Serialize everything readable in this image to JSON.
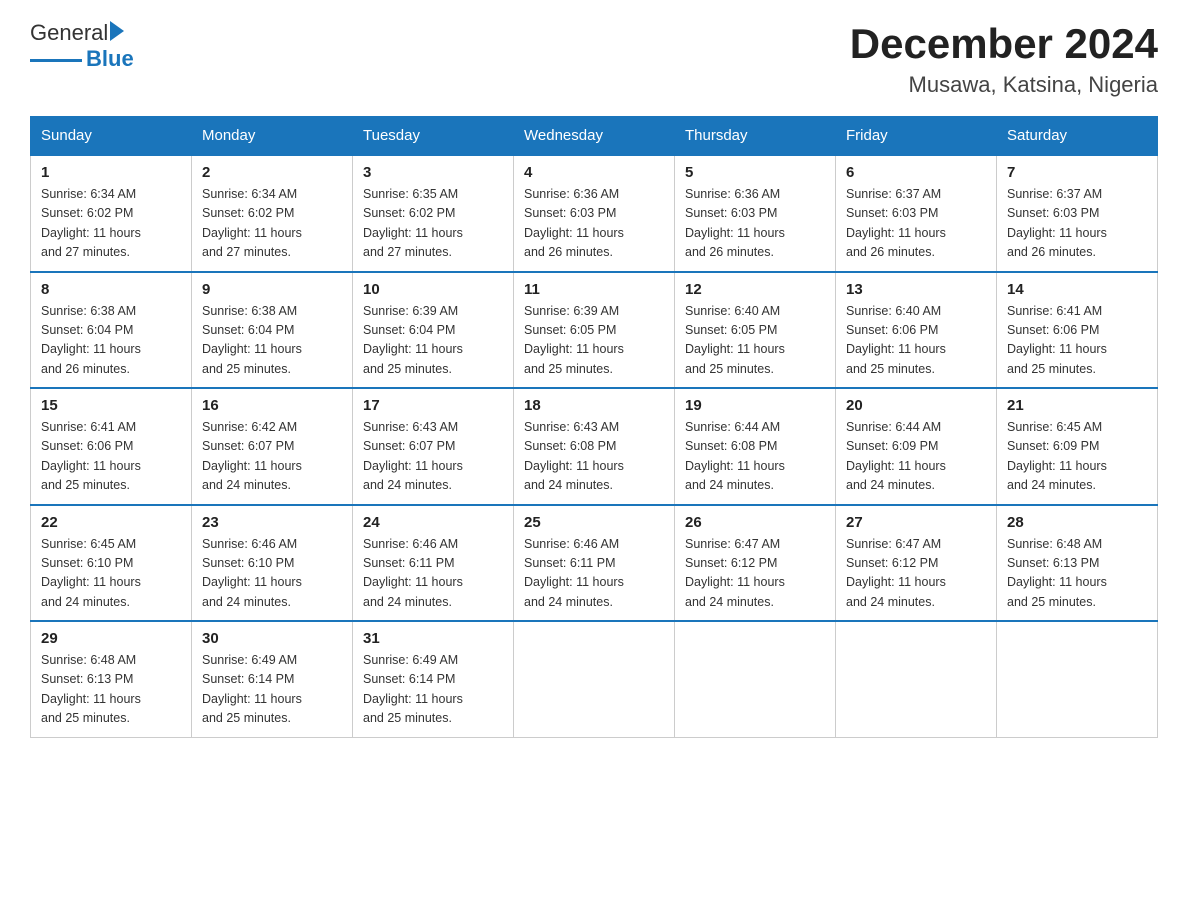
{
  "logo": {
    "general": "General",
    "blue": "Blue"
  },
  "title": "December 2024",
  "subtitle": "Musawa, Katsina, Nigeria",
  "weekdays": [
    "Sunday",
    "Monday",
    "Tuesday",
    "Wednesday",
    "Thursday",
    "Friday",
    "Saturday"
  ],
  "weeks": [
    [
      {
        "day": "1",
        "sunrise": "6:34 AM",
        "sunset": "6:02 PM",
        "daylight": "11 hours and 27 minutes."
      },
      {
        "day": "2",
        "sunrise": "6:34 AM",
        "sunset": "6:02 PM",
        "daylight": "11 hours and 27 minutes."
      },
      {
        "day": "3",
        "sunrise": "6:35 AM",
        "sunset": "6:02 PM",
        "daylight": "11 hours and 27 minutes."
      },
      {
        "day": "4",
        "sunrise": "6:36 AM",
        "sunset": "6:03 PM",
        "daylight": "11 hours and 26 minutes."
      },
      {
        "day": "5",
        "sunrise": "6:36 AM",
        "sunset": "6:03 PM",
        "daylight": "11 hours and 26 minutes."
      },
      {
        "day": "6",
        "sunrise": "6:37 AM",
        "sunset": "6:03 PM",
        "daylight": "11 hours and 26 minutes."
      },
      {
        "day": "7",
        "sunrise": "6:37 AM",
        "sunset": "6:03 PM",
        "daylight": "11 hours and 26 minutes."
      }
    ],
    [
      {
        "day": "8",
        "sunrise": "6:38 AM",
        "sunset": "6:04 PM",
        "daylight": "11 hours and 26 minutes."
      },
      {
        "day": "9",
        "sunrise": "6:38 AM",
        "sunset": "6:04 PM",
        "daylight": "11 hours and 25 minutes."
      },
      {
        "day": "10",
        "sunrise": "6:39 AM",
        "sunset": "6:04 PM",
        "daylight": "11 hours and 25 minutes."
      },
      {
        "day": "11",
        "sunrise": "6:39 AM",
        "sunset": "6:05 PM",
        "daylight": "11 hours and 25 minutes."
      },
      {
        "day": "12",
        "sunrise": "6:40 AM",
        "sunset": "6:05 PM",
        "daylight": "11 hours and 25 minutes."
      },
      {
        "day": "13",
        "sunrise": "6:40 AM",
        "sunset": "6:06 PM",
        "daylight": "11 hours and 25 minutes."
      },
      {
        "day": "14",
        "sunrise": "6:41 AM",
        "sunset": "6:06 PM",
        "daylight": "11 hours and 25 minutes."
      }
    ],
    [
      {
        "day": "15",
        "sunrise": "6:41 AM",
        "sunset": "6:06 PM",
        "daylight": "11 hours and 25 minutes."
      },
      {
        "day": "16",
        "sunrise": "6:42 AM",
        "sunset": "6:07 PM",
        "daylight": "11 hours and 24 minutes."
      },
      {
        "day": "17",
        "sunrise": "6:43 AM",
        "sunset": "6:07 PM",
        "daylight": "11 hours and 24 minutes."
      },
      {
        "day": "18",
        "sunrise": "6:43 AM",
        "sunset": "6:08 PM",
        "daylight": "11 hours and 24 minutes."
      },
      {
        "day": "19",
        "sunrise": "6:44 AM",
        "sunset": "6:08 PM",
        "daylight": "11 hours and 24 minutes."
      },
      {
        "day": "20",
        "sunrise": "6:44 AM",
        "sunset": "6:09 PM",
        "daylight": "11 hours and 24 minutes."
      },
      {
        "day": "21",
        "sunrise": "6:45 AM",
        "sunset": "6:09 PM",
        "daylight": "11 hours and 24 minutes."
      }
    ],
    [
      {
        "day": "22",
        "sunrise": "6:45 AM",
        "sunset": "6:10 PM",
        "daylight": "11 hours and 24 minutes."
      },
      {
        "day": "23",
        "sunrise": "6:46 AM",
        "sunset": "6:10 PM",
        "daylight": "11 hours and 24 minutes."
      },
      {
        "day": "24",
        "sunrise": "6:46 AM",
        "sunset": "6:11 PM",
        "daylight": "11 hours and 24 minutes."
      },
      {
        "day": "25",
        "sunrise": "6:46 AM",
        "sunset": "6:11 PM",
        "daylight": "11 hours and 24 minutes."
      },
      {
        "day": "26",
        "sunrise": "6:47 AM",
        "sunset": "6:12 PM",
        "daylight": "11 hours and 24 minutes."
      },
      {
        "day": "27",
        "sunrise": "6:47 AM",
        "sunset": "6:12 PM",
        "daylight": "11 hours and 24 minutes."
      },
      {
        "day": "28",
        "sunrise": "6:48 AM",
        "sunset": "6:13 PM",
        "daylight": "11 hours and 25 minutes."
      }
    ],
    [
      {
        "day": "29",
        "sunrise": "6:48 AM",
        "sunset": "6:13 PM",
        "daylight": "11 hours and 25 minutes."
      },
      {
        "day": "30",
        "sunrise": "6:49 AM",
        "sunset": "6:14 PM",
        "daylight": "11 hours and 25 minutes."
      },
      {
        "day": "31",
        "sunrise": "6:49 AM",
        "sunset": "6:14 PM",
        "daylight": "11 hours and 25 minutes."
      },
      null,
      null,
      null,
      null
    ]
  ],
  "labels": {
    "sunrise": "Sunrise:",
    "sunset": "Sunset:",
    "daylight": "Daylight:"
  }
}
